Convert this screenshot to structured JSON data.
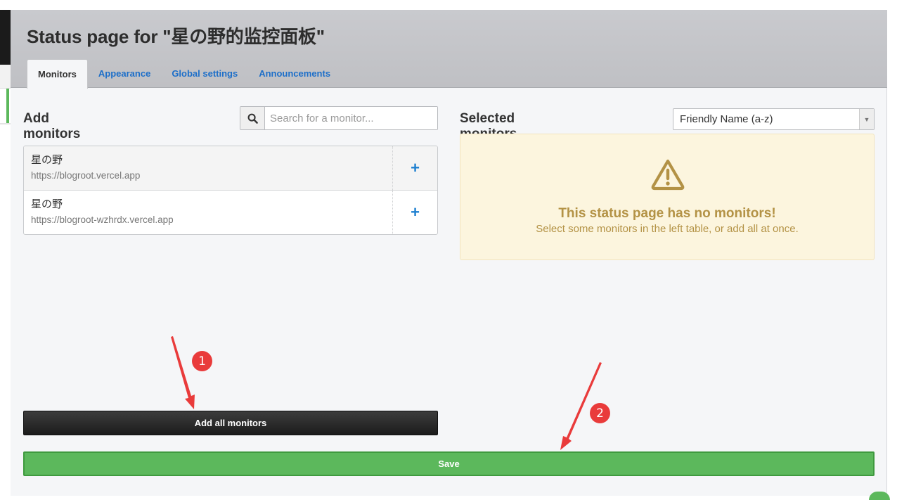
{
  "header": {
    "title": "Status page for \"星の野的监控面板\""
  },
  "tabs": [
    {
      "label": "Monitors",
      "active": true
    },
    {
      "label": "Appearance",
      "active": false
    },
    {
      "label": "Global settings",
      "active": false
    },
    {
      "label": "Announcements",
      "active": false
    }
  ],
  "add_monitors": {
    "title": "Add monitors",
    "search_placeholder": "Search for a monitor...",
    "search_value": "",
    "items": [
      {
        "name": "星の野",
        "url": "https://blogroot.vercel.app",
        "action": "+"
      },
      {
        "name": "星の野",
        "url": "https://blogroot-wzhrdx.vercel.app",
        "action": "+"
      }
    ],
    "add_all_label": "Add all monitors"
  },
  "selected_monitors": {
    "title": "Selected monitors",
    "sort_value": "Friendly Name (a-z)",
    "empty_title": "This status page has no monitors!",
    "empty_subtitle": "Select some monitors in the left table, or add all at once."
  },
  "footer": {
    "save_label": "Save"
  },
  "annotations": {
    "badge_1": "1",
    "badge_2": "2"
  },
  "colors": {
    "link": "#1d6fc9",
    "save_green": "#5cb85c",
    "warning_text": "#b39245",
    "warning_bg": "#fcf5de",
    "annotation_red": "#e93b3b"
  },
  "icons": {
    "search": "search-icon",
    "warning": "warning-icon",
    "add": "plus-icon",
    "dropdown": "caret-down-icon"
  }
}
